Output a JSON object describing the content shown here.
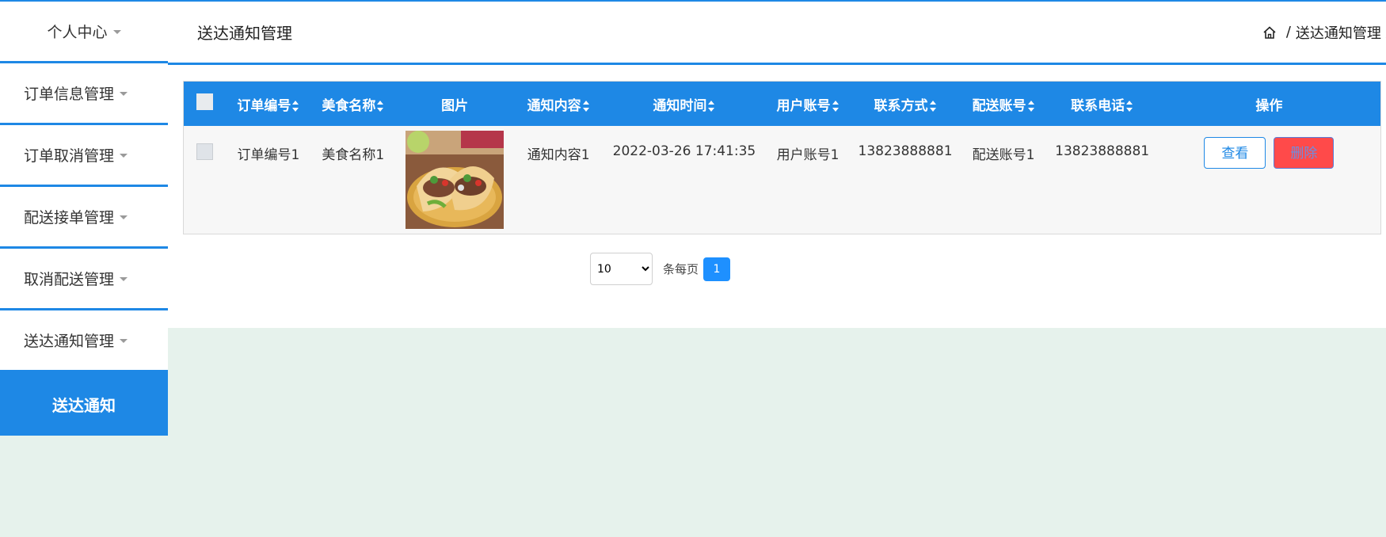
{
  "sidebar": {
    "header": "个人中心",
    "items": [
      {
        "label": "订单信息管理"
      },
      {
        "label": "订单取消管理"
      },
      {
        "label": "配送接单管理"
      },
      {
        "label": "取消配送管理"
      },
      {
        "label": "送达通知管理"
      }
    ],
    "active": "送达通知"
  },
  "header": {
    "title": "送达通知管理",
    "breadcrumb": [
      "送达通知管理"
    ]
  },
  "table": {
    "columns": [
      "订单编号",
      "美食名称",
      "图片",
      "通知内容",
      "通知时间",
      "用户账号",
      "联系方式",
      "配送账号",
      "联系电话",
      "操作"
    ],
    "rows": [
      {
        "order_no": "订单编号1",
        "food_name": "美食名称1",
        "image": "tacos-photo",
        "content": "通知内容1",
        "time": "2022-03-26 17:41:35",
        "user_account": "用户账号1",
        "contact": "13823888881",
        "delivery_account": "配送账号1",
        "phone": "13823888881",
        "view_label": "查看",
        "delete_label": "删除"
      }
    ]
  },
  "pagination": {
    "page_size": "10",
    "per_page_label": "条每页",
    "current_page": "1"
  },
  "colors": {
    "accent": "#1e88e5",
    "delete_bg": "#ff4a4a",
    "background": "#e6f2ec"
  }
}
